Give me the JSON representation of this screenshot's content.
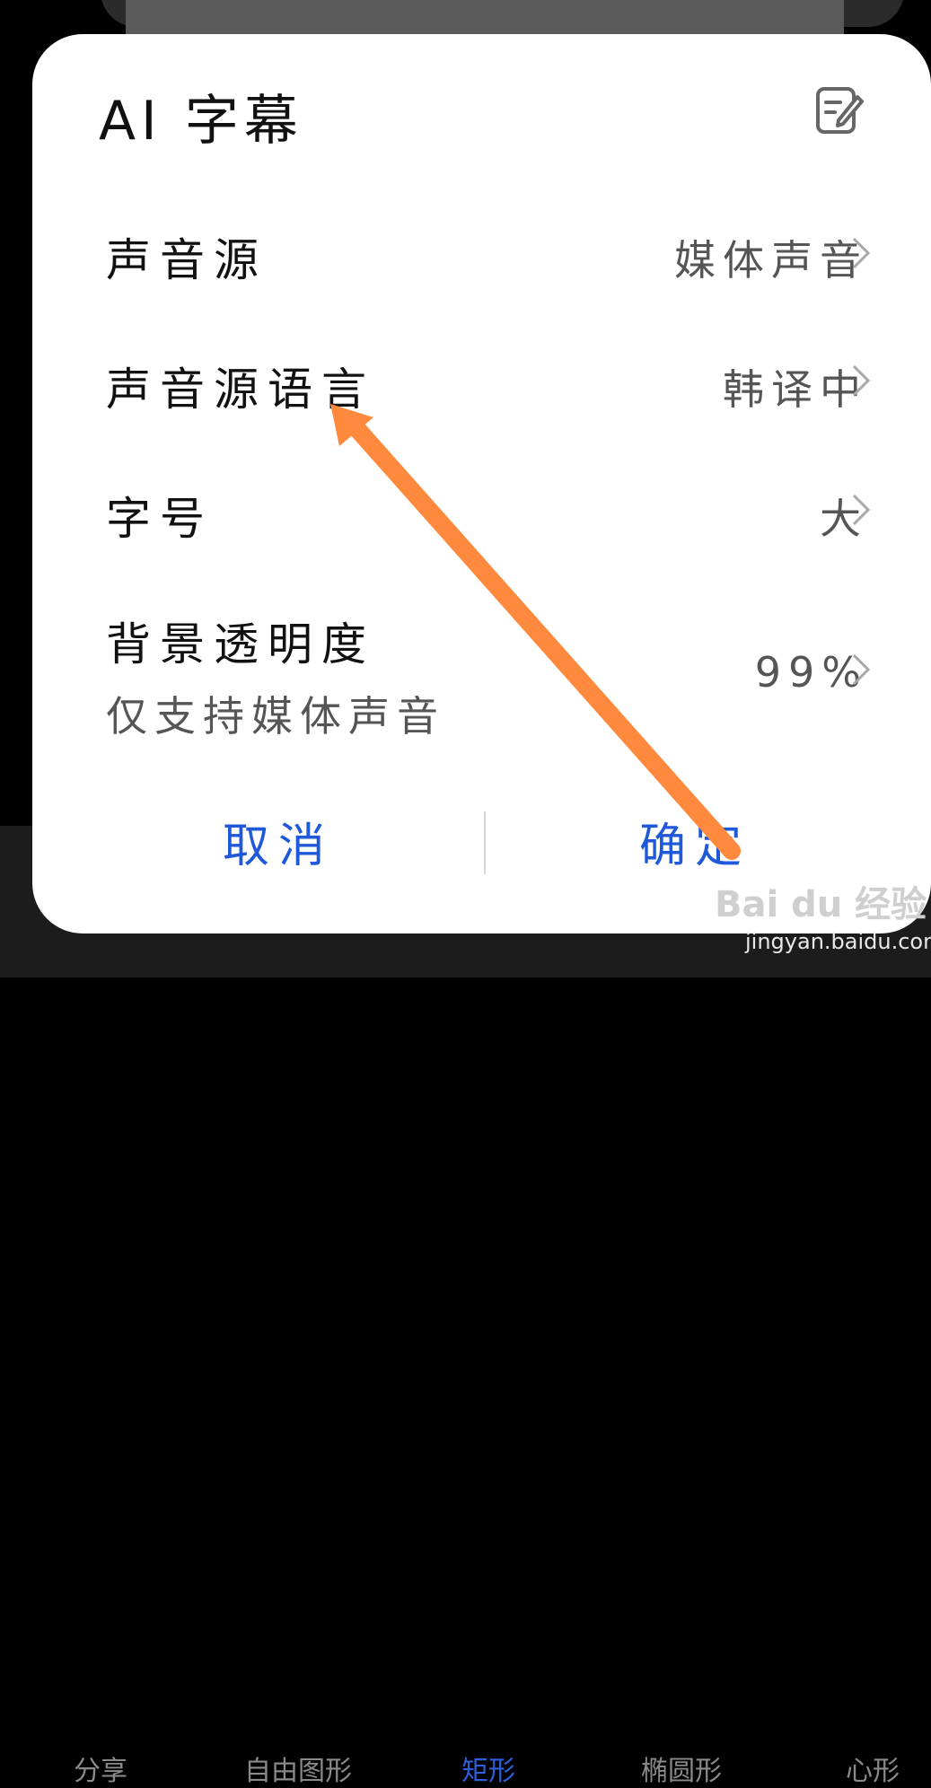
{
  "dialog": {
    "title": "AI 字幕",
    "rows": [
      {
        "label": "声音源",
        "value": "媒体声音"
      },
      {
        "label": "声音源语言",
        "value": "韩译中"
      },
      {
        "label": "字号",
        "value": "大"
      },
      {
        "label": "背景透明度",
        "sublabel": "仅支持媒体声音",
        "value": "99%"
      }
    ],
    "cancel_label": "取消",
    "confirm_label": "确定"
  },
  "bottom_bar": {
    "tabs": [
      "分享",
      "自由图形",
      "矩形",
      "椭圆形",
      "心形"
    ],
    "active_index": 2
  },
  "watermark": {
    "brand": "Bai du 经验",
    "url": "jingyan.baidu.com"
  },
  "colors": {
    "accent": "#1f58d8",
    "arrow": "#ff8a3d",
    "dialog_bg": "#ffffff"
  },
  "icons": {
    "edit": "edit-note-icon",
    "chevron": "chevron-right-icon"
  }
}
